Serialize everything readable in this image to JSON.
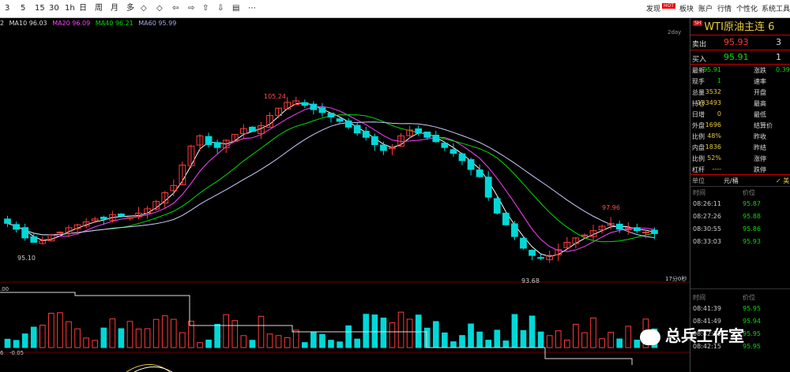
{
  "toolbar": {
    "periods": [
      "3",
      "5",
      "15",
      "30",
      "1h",
      "日",
      "周",
      "月",
      "多"
    ],
    "right_items": [
      "发现",
      "板块",
      "账户",
      "行情",
      "个性化",
      "系统工具"
    ],
    "hot_badge": "HOT"
  },
  "legend": {
    "ma10": "MA10 96.03",
    "ma20": "MA20 96.09",
    "ma40": "MA40 96.21",
    "ma60": "MA60 95.99",
    "prefix": "2"
  },
  "chart_labels": {
    "high": "105.24",
    "low_left": "95.10",
    "low_right": "93.68",
    "peak_right": "97.96",
    "right_tag": "2day",
    "time_tag": "17分0秒",
    "vol_left": ".00",
    "macd_left": "-0.05",
    "macd_prefix": "6"
  },
  "colors": {
    "up": "#ff3b3b",
    "down": "#00d8d8",
    "ma10": "#ffffff",
    "ma20": "#ff40ff",
    "ma40": "#00e000",
    "ma60": "#ccccff"
  },
  "side": {
    "title": "WTI原油主连",
    "title_suffix": "6",
    "sell_label": "卖出",
    "sell_price": "95.93",
    "sell_qty": "3",
    "buy_label": "买入",
    "buy_price": "95.91",
    "buy_qty": "1",
    "stats": [
      {
        "l1": "最新",
        "v1": "95.91",
        "l2": "涨跌",
        "v2": "0.39"
      },
      {
        "l1": "现手",
        "v1": "1",
        "l2": "速率",
        "v2": ""
      },
      {
        "l1": "总量",
        "v1": "3532",
        "l2": "开盘",
        "v2": ""
      },
      {
        "l1": "持仓",
        "v1": "133493",
        "l2": "最高",
        "v2": ""
      },
      {
        "l1": "日增",
        "v1": "0",
        "l2": "最低",
        "v2": ""
      },
      {
        "l1": "外盘",
        "v1": "1696",
        "l2": "结算价",
        "v2": ""
      },
      {
        "l1": "比例",
        "v1": "48%",
        "l2": "昨收",
        "v2": ""
      },
      {
        "l1": "内盘",
        "v1": "1836",
        "l2": "昨结",
        "v2": ""
      },
      {
        "l1": "比例",
        "v1": "52%",
        "l2": "涨停",
        "v2": ""
      },
      {
        "l1": "杠杆",
        "v1": "----",
        "l2": "跌停",
        "v2": ""
      }
    ],
    "unit_label": "单位",
    "unit_value": "元/桶",
    "unit_extra": "✓ 美",
    "ticks_header": {
      "time": "时间",
      "price": "价位"
    },
    "ticks": [
      {
        "time": "08:26:11",
        "price": "95.87"
      },
      {
        "time": "08:27:26",
        "price": "95.88"
      },
      {
        "time": "08:30:55",
        "price": "95.86"
      },
      {
        "time": "08:33:03",
        "price": "95.93"
      }
    ],
    "ticks2_header": {
      "time": "时间",
      "price": "价位"
    },
    "ticks2": [
      {
        "time": "08:41:39",
        "price": "95.95"
      },
      {
        "time": "08:41:49",
        "price": "95.94"
      },
      {
        "time": "08:42:15",
        "price": "95.95"
      },
      {
        "time": "08:42:15",
        "price": "95.95"
      }
    ]
  },
  "watermark": "总兵工作室",
  "chart_data": {
    "type": "candlestick",
    "title": "",
    "close": [
      96.6,
      96.2,
      95.6,
      95.3,
      95.4,
      95.8,
      96.0,
      96.3,
      96.5,
      96.7,
      96.9,
      96.9,
      97.2,
      97.1,
      97.0,
      97.3,
      97.6,
      98.1,
      98.7,
      99.2,
      100.6,
      101.9,
      102.6,
      102.0,
      101.8,
      102.3,
      102.7,
      103.1,
      102.9,
      103.3,
      104.0,
      104.5,
      104.9,
      105.0,
      104.7,
      104.4,
      104.2,
      103.9,
      103.6,
      103.2,
      102.8,
      102.5,
      102.0,
      101.6,
      101.8,
      102.6,
      103.0,
      102.8,
      102.5,
      102.2,
      101.8,
      101.4,
      100.9,
      100.3,
      99.8,
      98.4,
      97.3,
      96.5,
      95.7,
      94.9,
      94.4,
      94.2,
      94.4,
      94.8,
      95.3,
      95.6,
      95.8,
      96.1,
      96.4,
      96.6,
      96.2,
      96.3,
      96.1,
      96.0,
      95.9
    ],
    "price_high": 105.24,
    "price_low": 93.68,
    "annotations": [
      "105.24",
      "95.10",
      "93.68",
      "97.96"
    ]
  }
}
